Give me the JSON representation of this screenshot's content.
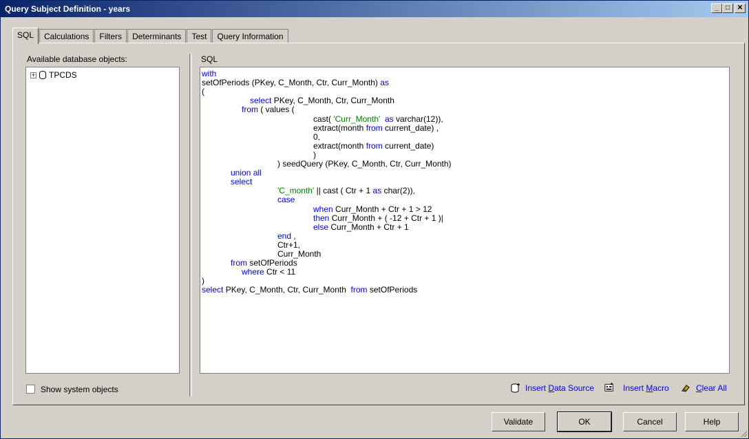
{
  "window": {
    "title": "Query Subject Definition - years"
  },
  "titlebar_buttons": {
    "minimize": "_",
    "maximize": "□",
    "close": "✕"
  },
  "tabs": [
    {
      "label": "SQL",
      "active": true
    },
    {
      "label": "Calculations"
    },
    {
      "label": "Filters"
    },
    {
      "label": "Determinants"
    },
    {
      "label": "Test"
    },
    {
      "label": "Query Information"
    }
  ],
  "left": {
    "label": "Available database objects:",
    "tree_item": "TPCDS",
    "expander": "+",
    "show_system_label": "Show system objects"
  },
  "sql": {
    "label": "SQL",
    "lines": [
      {
        "indent": 0,
        "parts": [
          {
            "t": "with",
            "k": "kw"
          }
        ]
      },
      {
        "indent": 0,
        "parts": [
          {
            "t": "setOfPeriods (PKey, C_Month, Ctr, Curr_Month) "
          },
          {
            "t": "as",
            "k": "kw"
          }
        ]
      },
      {
        "indent": 0,
        "parts": [
          {
            "t": "("
          }
        ]
      },
      {
        "indent": 70,
        "parts": [
          {
            "t": "select",
            "k": "kw"
          },
          {
            "t": " PKey, C_Month, Ctr, Curr_Month"
          }
        ]
      },
      {
        "indent": 58,
        "parts": [
          {
            "t": "from",
            "k": "kw"
          },
          {
            "t": " ( values ("
          }
        ]
      },
      {
        "indent": 162,
        "parts": [
          {
            "t": "cast( "
          },
          {
            "t": "'Curr_Month'",
            "k": "str"
          },
          {
            "t": "  "
          },
          {
            "t": "as",
            "k": "kw"
          },
          {
            "t": " varchar(12)),"
          }
        ]
      },
      {
        "indent": 162,
        "parts": [
          {
            "t": "extract(month "
          },
          {
            "t": "from",
            "k": "kw"
          },
          {
            "t": " current_date) ,"
          }
        ]
      },
      {
        "indent": 162,
        "parts": [
          {
            "t": "0,"
          }
        ]
      },
      {
        "indent": 162,
        "parts": [
          {
            "t": "extract(month "
          },
          {
            "t": "from",
            "k": "kw"
          },
          {
            "t": " current_date)"
          }
        ]
      },
      {
        "indent": 162,
        "parts": [
          {
            "t": ")"
          }
        ]
      },
      {
        "indent": 110,
        "parts": [
          {
            "t": ") seedQuery (PKey, C_Month, Ctr, Curr_Month)"
          }
        ]
      },
      {
        "indent": 42,
        "parts": [
          {
            "t": "union all",
            "k": "kw"
          }
        ]
      },
      {
        "indent": 42,
        "parts": [
          {
            "t": "select",
            "k": "kw"
          }
        ]
      },
      {
        "indent": 110,
        "parts": [
          {
            "t": "'C_month'",
            "k": "str"
          },
          {
            "t": " || cast ( Ctr + 1 "
          },
          {
            "t": "as",
            "k": "kw"
          },
          {
            "t": " char(2)),"
          }
        ]
      },
      {
        "indent": 110,
        "parts": [
          {
            "t": "case",
            "k": "kw"
          }
        ]
      },
      {
        "indent": 162,
        "parts": [
          {
            "t": "when",
            "k": "kw"
          },
          {
            "t": " Curr_Month + Ctr + 1 > 12"
          }
        ]
      },
      {
        "indent": 162,
        "parts": [
          {
            "t": "then",
            "k": "kw"
          },
          {
            "t": " Curr_Month + ( -12 + Ctr + 1 )|"
          }
        ]
      },
      {
        "indent": 162,
        "parts": [
          {
            "t": "else",
            "k": "kw"
          },
          {
            "t": " Curr_Month + Ctr + 1"
          }
        ]
      },
      {
        "indent": 110,
        "parts": [
          {
            "t": "end",
            "k": "kw"
          },
          {
            "t": " ,"
          }
        ]
      },
      {
        "indent": 110,
        "parts": [
          {
            "t": "Ctr+1,"
          }
        ]
      },
      {
        "indent": 110,
        "parts": [
          {
            "t": "Curr_Month"
          }
        ]
      },
      {
        "indent": 42,
        "parts": [
          {
            "t": "from",
            "k": "kw"
          },
          {
            "t": " setOfPeriods"
          }
        ]
      },
      {
        "indent": 58,
        "parts": [
          {
            "t": "where",
            "k": "kw"
          },
          {
            "t": " Ctr < 11"
          }
        ]
      },
      {
        "indent": 0,
        "parts": [
          {
            "t": ")"
          }
        ]
      },
      {
        "indent": 0,
        "parts": [
          {
            "t": "select",
            "k": "kw"
          },
          {
            "t": " PKey, C_Month, Ctr, Curr_Month  "
          },
          {
            "t": "from",
            "k": "kw"
          },
          {
            "t": " setOfPeriods"
          }
        ]
      }
    ]
  },
  "actions": {
    "insert_data_source": {
      "pre": "Insert ",
      "ul": "D",
      "post": "ata Source",
      "icon": "insert-data-source-icon"
    },
    "insert_macro": {
      "pre": "Insert ",
      "ul": "M",
      "post": "acro",
      "icon": "insert-macro-icon"
    },
    "clear_all": {
      "pre": "",
      "ul": "C",
      "post": "lear All",
      "icon": "eraser-icon"
    }
  },
  "buttons": {
    "validate": "Validate",
    "ok": "OK",
    "cancel": "Cancel",
    "help": "Help"
  },
  "colors": {
    "keyword": "#0000ff",
    "string": "#008000",
    "title_start": "#0a246a",
    "title_end": "#a6caf0"
  }
}
